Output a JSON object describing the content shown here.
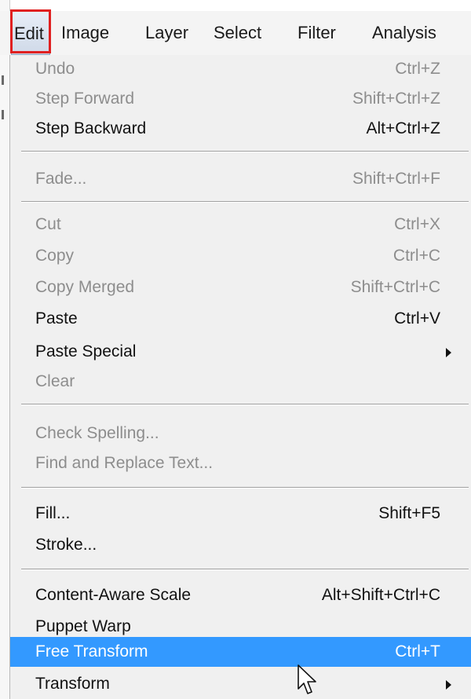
{
  "menubar": {
    "items": [
      "Edit",
      "Image",
      "Layer",
      "Select",
      "Filter",
      "Analysis"
    ]
  },
  "menu": {
    "items": [
      {
        "label": "Undo",
        "shortcut": "Ctrl+Z",
        "enabled": false
      },
      {
        "label": "Step Forward",
        "shortcut": "Shift+Ctrl+Z",
        "enabled": false
      },
      {
        "label": "Step Backward",
        "shortcut": "Alt+Ctrl+Z",
        "enabled": true
      },
      {
        "label": "Fade...",
        "shortcut": "Shift+Ctrl+F",
        "enabled": false
      },
      {
        "label": "Cut",
        "shortcut": "Ctrl+X",
        "enabled": false
      },
      {
        "label": "Copy",
        "shortcut": "Ctrl+C",
        "enabled": false
      },
      {
        "label": "Copy Merged",
        "shortcut": "Shift+Ctrl+C",
        "enabled": false
      },
      {
        "label": "Paste",
        "shortcut": "Ctrl+V",
        "enabled": true
      },
      {
        "label": "Paste Special",
        "shortcut": "",
        "enabled": true,
        "submenu": true
      },
      {
        "label": "Clear",
        "shortcut": "",
        "enabled": false
      },
      {
        "label": "Check Spelling...",
        "shortcut": "",
        "enabled": false
      },
      {
        "label": "Find and Replace Text...",
        "shortcut": "",
        "enabled": false
      },
      {
        "label": "Fill...",
        "shortcut": "Shift+F5",
        "enabled": true
      },
      {
        "label": "Stroke...",
        "shortcut": "",
        "enabled": true
      },
      {
        "label": "Content-Aware Scale",
        "shortcut": "Alt+Shift+Ctrl+C",
        "enabled": true
      },
      {
        "label": "Puppet Warp",
        "shortcut": "",
        "enabled": true
      },
      {
        "label": "Free Transform",
        "shortcut": "Ctrl+T",
        "enabled": true,
        "selected": true
      },
      {
        "label": "Transform",
        "shortcut": "",
        "enabled": true,
        "submenu": true
      }
    ]
  },
  "colors": {
    "selection": "#3399ff",
    "highlight_box": "#e02020",
    "disabled_text": "#8d8d8d"
  },
  "icons": {
    "submenu": "submenu-arrow-icon",
    "cursor": "mouse-cursor-icon"
  }
}
